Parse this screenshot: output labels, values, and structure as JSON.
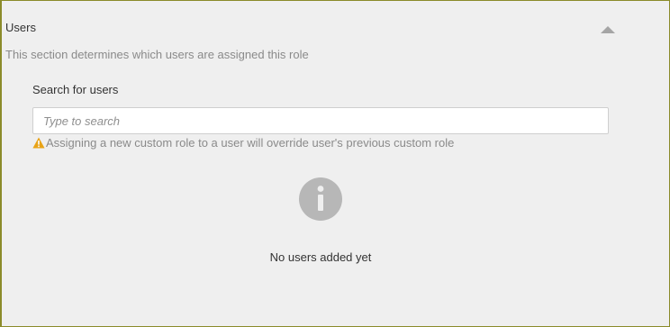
{
  "section": {
    "title": "Users",
    "description": "This section determines which users are assigned this role",
    "collapse_icon": "chevron-up-icon"
  },
  "search": {
    "label": "Search for users",
    "placeholder": "Type to search",
    "value": ""
  },
  "warning": {
    "icon": "warning-icon",
    "text": "Assigning a new custom role to a user will override user's previous custom role"
  },
  "empty_state": {
    "icon": "info-icon",
    "text": "No users added yet"
  },
  "colors": {
    "panel_border": "#8b8b2a",
    "background": "#efefef",
    "warning_accent": "#e8a317",
    "info_icon": "#b7b7b7"
  }
}
